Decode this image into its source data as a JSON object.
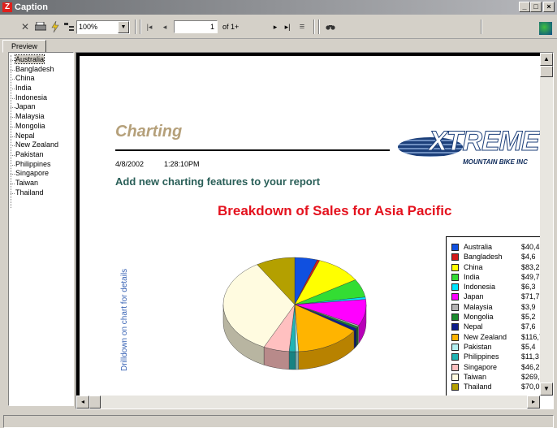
{
  "window": {
    "title": "Caption",
    "minimize_glyph": "_",
    "maximize_glyph": "□",
    "close_glyph": "×"
  },
  "toolbar": {
    "zoom_value": "100%",
    "page_value": "1",
    "page_of": "of 1+"
  },
  "tabs": [
    {
      "label": "Preview"
    }
  ],
  "tree": {
    "items": [
      "Australia",
      "Bangladesh",
      "China",
      "India",
      "Indonesia",
      "Japan",
      "Malaysia",
      "Mongolia",
      "Nepal",
      "New Zealand",
      "Pakistan",
      "Philippines",
      "Singapore",
      "Taiwan",
      "Thailand"
    ],
    "selected": "Australia"
  },
  "report": {
    "title": "Charting",
    "date": "4/8/2002",
    "time": "1:28:10PM",
    "subtitle": "Add new charting features to your report",
    "logo_main": "XTREME",
    "logo_sub": "MOUNTAIN BIKE INC",
    "drill_label": "Drilldown on chart for details"
  },
  "colors": {
    "title_tan": "#b5a07a",
    "subtitle_teal": "#2a5f58",
    "chart_title_red": "#e4121e",
    "drill_blue": "#3a64b5"
  },
  "chart_data": {
    "type": "pie",
    "title": "Breakdown of Sales for Asia Pacific",
    "categories": [
      "Australia",
      "Bangladesh",
      "China",
      "India",
      "Indonesia",
      "Japan",
      "Malaysia",
      "Mongolia",
      "Nepal",
      "New Zealand",
      "Pakistan",
      "Philippines",
      "Singapore",
      "Taiwan",
      "Thailand"
    ],
    "value_labels": [
      "$40,4",
      "$4,6",
      "$83,2",
      "$49,7",
      "$6,3",
      "$71,7",
      "$3,9",
      "$5,2",
      "$7,6",
      "$116,7",
      "$5,4",
      "$11,3",
      "$46,2",
      "$269,9",
      "$70,0"
    ],
    "values": [
      40.4,
      4.6,
      83.2,
      49.7,
      6.3,
      71.7,
      3.9,
      5.2,
      7.6,
      116.7,
      5.4,
      11.3,
      46.2,
      269.9,
      70.0
    ],
    "colors": [
      "#1050e0",
      "#d41a1a",
      "#ffff00",
      "#33dd33",
      "#00e5ff",
      "#ff00ff",
      "#b4b4b4",
      "#1b8c2e",
      "#0e1e8c",
      "#ffb400",
      "#b4f0f0",
      "#20b4b4",
      "#ffc0c0",
      "#fffbe0",
      "#b4a000"
    ],
    "legend_position": "right"
  }
}
